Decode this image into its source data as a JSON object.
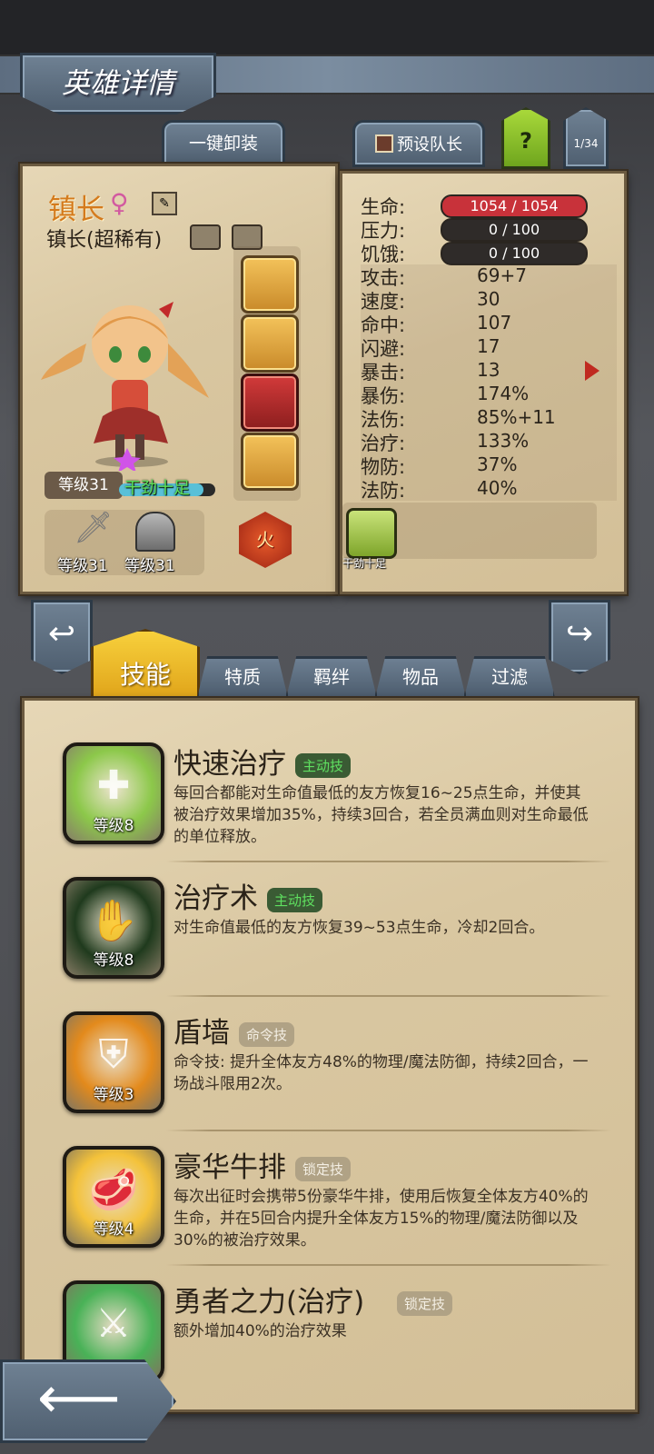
{
  "header": {
    "title": "英雄详情"
  },
  "toolbar": {
    "unequip_all": "一键卸装",
    "preset_leader": "预设队长",
    "help": "?",
    "page_counter": "1/34"
  },
  "hero": {
    "name": "镇长",
    "subtitle": "镇长(超稀有)",
    "level": "等级31",
    "status": "干劲十足",
    "weapon_level": "等级31",
    "armor_level": "等级31",
    "element": "火"
  },
  "stats": [
    {
      "label": "生命:",
      "value": "1054 / 1054",
      "type": "bar",
      "color": "#c8323a"
    },
    {
      "label": "压力:",
      "value": "0 / 100",
      "type": "bar",
      "color": "#2f2b29"
    },
    {
      "label": "饥饿:",
      "value": "0 / 100",
      "type": "bar",
      "color": "#2f2b29"
    },
    {
      "label": "攻击:",
      "value": "69+7"
    },
    {
      "label": "速度:",
      "value": "30"
    },
    {
      "label": "命中:",
      "value": "107"
    },
    {
      "label": "闪避:",
      "value": "17"
    },
    {
      "label": "暴击:",
      "value": "13"
    },
    {
      "label": "暴伤:",
      "value": "174%"
    },
    {
      "label": "法伤:",
      "value": "85%+11"
    },
    {
      "label": "治疗:",
      "value": "133%"
    },
    {
      "label": "物防:",
      "value": "37%"
    },
    {
      "label": "法防:",
      "value": "40%"
    }
  ],
  "trait_badge": {
    "label": "干劲十足"
  },
  "tabs": [
    {
      "label": "技能",
      "active": true
    },
    {
      "label": "特质"
    },
    {
      "label": "羁绊"
    },
    {
      "label": "物品"
    },
    {
      "label": "过滤"
    }
  ],
  "skills": [
    {
      "name": "快速治疗",
      "tag": "主动技",
      "level": "等级8",
      "desc": "每回合都能对生命值最低的友方恢复16~25点生命，并使其被治疗效果增加35%，持续3回合，若全员满血则对生命最低的单位释放。",
      "icon": "cross-heal-icon",
      "color": "#8cc84a",
      "tag_color": "#2f7a3a"
    },
    {
      "name": "治疗术",
      "tag": "主动技",
      "level": "等级8",
      "desc": "对生命值最低的友方恢复39~53点生命，冷却2回合。",
      "icon": "green-hand-icon",
      "color": "#1f3a1d",
      "tag_color": "#2f7a3a"
    },
    {
      "name": "盾墙",
      "tag": "命令技",
      "level": "等级3",
      "desc": "命令技: 提升全体友方48%的物理/魔法防御，持续2回合，一场战斗限用2次。",
      "icon": "shield-icon",
      "color": "#e38a1c",
      "tag_color": "#5a4a36"
    },
    {
      "name": "豪华牛排",
      "tag": "锁定技",
      "level": "等级4",
      "desc": "每次出征时会携带5份豪华牛排，使用后恢复全体友方40%的生命，并在5回合内提升全体友方15%的物理/魔法防御以及30%的被治疗效果。",
      "icon": "steak-icon",
      "color": "#f4c23a",
      "tag_color": "#7a6c58"
    },
    {
      "name": "勇者之力(治疗)",
      "tag": "锁定技",
      "level": "",
      "desc": "额外增加40%的治疗效果",
      "icon": "hero-power-icon",
      "color": "#49b257",
      "tag_color": "#7a6c58"
    }
  ]
}
